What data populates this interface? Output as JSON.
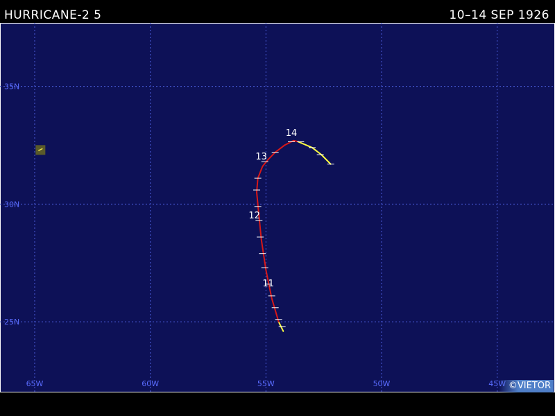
{
  "header": {
    "storm_name": "HURRICANE-2 5",
    "date_range": "10–14 SEP 1926"
  },
  "credit": "©VIETOR",
  "map": {
    "background_color": "#0d1157",
    "grid_color": "#4a5bd8",
    "label_color": "#5a6cff",
    "lon_range": [
      -66.5,
      -42.5
    ],
    "lat_range": [
      22.0,
      37.7
    ],
    "lat_gridlines": [
      {
        "value": 35,
        "label": "35N"
      },
      {
        "value": 30,
        "label": "30N"
      },
      {
        "value": 25,
        "label": "25N"
      }
    ],
    "lon_gridlines": [
      {
        "value": -65,
        "label": "65W"
      },
      {
        "value": -60,
        "label": "60W"
      },
      {
        "value": -55,
        "label": "55W"
      },
      {
        "value": -50,
        "label": "50W"
      },
      {
        "value": -45,
        "label": "45W"
      }
    ],
    "land": [
      {
        "name": "Bermuda",
        "lon": -64.75,
        "lat": 32.3
      }
    ]
  },
  "track": {
    "hurricane_color": "#d81818",
    "storm_color": "#ffff40",
    "tick_color": "#ffffff",
    "segments": [
      {
        "intensity": "storm",
        "points": [
          [
            -54.25,
            24.6
          ],
          [
            -54.45,
            25.0
          ]
        ]
      },
      {
        "intensity": "hurricane",
        "points": [
          [
            -54.45,
            25.0
          ],
          [
            -54.75,
            26.0
          ],
          [
            -55.0,
            27.2
          ],
          [
            -55.2,
            28.5
          ],
          [
            -55.3,
            29.5
          ],
          [
            -55.4,
            30.5
          ],
          [
            -55.35,
            31.1
          ],
          [
            -55.15,
            31.6
          ],
          [
            -54.9,
            31.9
          ],
          [
            -54.6,
            32.2
          ],
          [
            -54.2,
            32.5
          ],
          [
            -53.8,
            32.7
          ],
          [
            -53.6,
            32.65
          ]
        ]
      },
      {
        "intensity": "storm",
        "points": [
          [
            -53.6,
            32.65
          ],
          [
            -53.0,
            32.4
          ],
          [
            -52.6,
            32.1
          ],
          [
            -52.2,
            31.7
          ]
        ]
      }
    ],
    "ticks": [
      [
        -54.3,
        24.8
      ],
      [
        -54.45,
        25.1
      ],
      [
        -54.6,
        25.6
      ],
      [
        -54.75,
        26.1
      ],
      [
        -54.9,
        26.6
      ],
      [
        -55.05,
        27.3
      ],
      [
        -55.15,
        27.9
      ],
      [
        -55.25,
        28.6
      ],
      [
        -55.3,
        29.3
      ],
      [
        -55.35,
        29.9
      ],
      [
        -55.4,
        30.6
      ],
      [
        -55.35,
        31.1
      ],
      [
        -55.05,
        31.8
      ],
      [
        -54.6,
        32.2
      ],
      [
        -53.9,
        32.65
      ],
      [
        -53.5,
        32.65
      ],
      [
        -53.0,
        32.4
      ],
      [
        -52.65,
        32.1
      ],
      [
        -52.2,
        31.7
      ]
    ],
    "day_labels": [
      {
        "label": "11",
        "lon": -54.9,
        "lat": 26.5
      },
      {
        "label": "12",
        "lon": -55.5,
        "lat": 29.4
      },
      {
        "label": "13",
        "lon": -55.2,
        "lat": 31.9
      },
      {
        "label": "14",
        "lon": -53.9,
        "lat": 32.9
      }
    ]
  }
}
